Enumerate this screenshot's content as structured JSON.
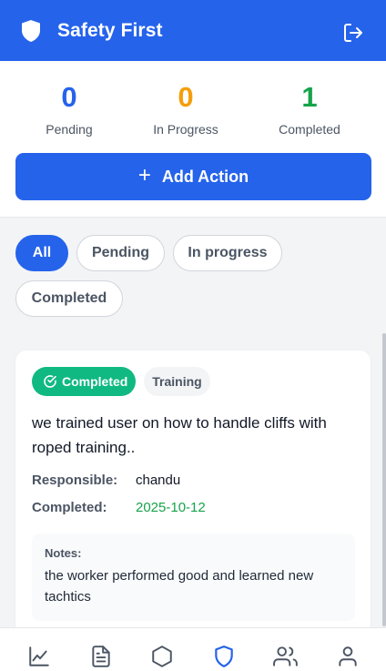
{
  "header": {
    "title": "Safety First",
    "shield_icon": "shield-icon",
    "logout_icon": "logout-icon"
  },
  "stats": {
    "pending": {
      "value": "0",
      "label": "Pending",
      "color": "#2563eb"
    },
    "in_progress": {
      "value": "0",
      "label": "In Progress",
      "color": "#f59e0b"
    },
    "completed": {
      "value": "1",
      "label": "Completed",
      "color": "#16a34a"
    }
  },
  "add_action": {
    "plus": "+",
    "label": "Add Action"
  },
  "filters": {
    "all": "All",
    "pending": "Pending",
    "in_progress": "In progress",
    "completed": "Completed",
    "active": "All"
  },
  "card": {
    "status": "Completed",
    "category": "Training",
    "description": "we trained user on how to handle cliffs with roped training..",
    "responsible_label": "Responsible:",
    "responsible_value": "chandu",
    "completed_label": "Completed:",
    "completed_value": "2025-10-12",
    "notes_label": "Notes:",
    "notes_text": "the worker performed good and learned new tachtics"
  },
  "nav": {
    "items": [
      "chart-icon",
      "document-icon",
      "hexagon-icon",
      "shield-icon",
      "users-icon",
      "profile-icon"
    ],
    "active": "shield-icon"
  },
  "colors": {
    "primary": "#2563eb",
    "success": "#10b981",
    "warning": "#f59e0b"
  }
}
